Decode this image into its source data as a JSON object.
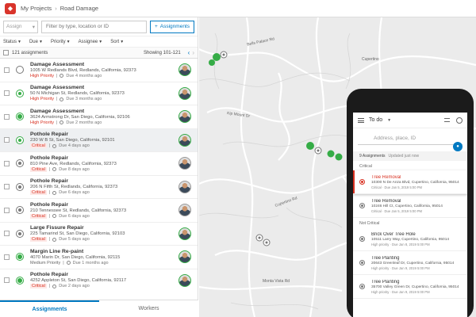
{
  "breadcrumb": {
    "root": "My Projects",
    "sep": "›",
    "current": "Road Damage"
  },
  "toolbar": {
    "assign_label": "Assign",
    "filter_placeholder": "Filter by type, location or ID",
    "assignments_button": "Assignments"
  },
  "sortbar": {
    "status": "Status",
    "due": "Due",
    "priority": "Priority",
    "assignee": "Assignee",
    "sort": "Sort"
  },
  "countbar": {
    "count": "121 assignments",
    "showing": "Showing 101-121"
  },
  "rows": [
    {
      "title": "Damage Assessment",
      "addr": "1005 W Redlands Blvd, Redlands, California, 92373",
      "priority": "High Priority",
      "due": "Due 4 months ago"
    },
    {
      "title": "Damage Assessment",
      "addr": "50 N Michigan St, Redlands, California, 92373",
      "priority": "High Priority",
      "due": "Due 3 months ago"
    },
    {
      "title": "Damage Assessment",
      "addr": "3624 Armstrong Dr, San Diego, California, 92106",
      "priority": "High Priority",
      "due": "Due 2 months ago"
    },
    {
      "title": "Pothole Repair",
      "addr": "230 W B St, San Diego, California, 92101",
      "priority": "Critical",
      "due": "Due 4 days ago"
    },
    {
      "title": "Pothole Repair",
      "addr": "810 Pine Ave, Redlands, California, 92373",
      "priority": "Critical",
      "due": "Due 8 days ago"
    },
    {
      "title": "Pothole Repair",
      "addr": "206 N Fifth St, Redlands, California, 92373",
      "priority": "Critical",
      "due": "Due 6 days ago"
    },
    {
      "title": "Pothole Repair",
      "addr": "210 Tennessee St, Redlands, California, 92373",
      "priority": "Critical",
      "due": "Due 6 days ago"
    },
    {
      "title": "Large Fissure Repair",
      "addr": "225 Tamarind St, San Diego, California, 92103",
      "priority": "Critical",
      "due": "Due 5 days ago"
    },
    {
      "title": "Margin Line Re-paint",
      "addr": "4070 Marin Dr, San Diego, California, 92115",
      "priority": "Medium Priority",
      "due": "Due 1 months ago"
    },
    {
      "title": "Pothole Repair",
      "addr": "4252 Appleton St, San Diego, California, 92117",
      "priority": "Critical",
      "due": "Due 2 days ago"
    }
  ],
  "tabs": {
    "assignments": "Assignments",
    "workers": "Workers"
  },
  "map_labels": [
    "Bells Palace Rd",
    "Kip Mount Dr",
    "Cupertino",
    "Cupertino Rd",
    "Monta Vista Rd"
  ],
  "phone": {
    "title": "To do",
    "search_placeholder": "Address, place, ID",
    "count": "9 Assignments",
    "updated": "Updated just now",
    "sections": {
      "critical": "Critical",
      "not_critical": "Not Critical"
    },
    "items": [
      {
        "title": "Tree Removal",
        "addr": "10300 N De Anza Blvd, Cupertino, California, 95014",
        "meta": "Critical · Due Jan 5, 2019 5:00 PM"
      },
      {
        "title": "Tree Removal",
        "addr": "10246 Hill Ct, Cupertino, California, 95014",
        "meta": "Critical · Due Jan 5, 2019 5:00 PM"
      },
      {
        "title": "Brick Over Tree Hole",
        "addr": "10511 Larry Way, Cupertino, California, 95014",
        "meta": "High priority · Due Jan 8, 2019 5:00 PM"
      },
      {
        "title": "Tree Planting",
        "addr": "20643 Greenleaf Dr, Cupertino, California, 95014",
        "meta": "High priority · Due Jan 9, 2019 5:00 PM"
      },
      {
        "title": "Tree Planting",
        "addr": "35700 Valley Green Dr, Cupertino, California, 95014",
        "meta": "High priority · Due Jan 9, 2019 5:00 PM"
      }
    ]
  },
  "colors": {
    "accent": "#0079c1",
    "critical": "#d83020",
    "complete": "#35ac46"
  }
}
